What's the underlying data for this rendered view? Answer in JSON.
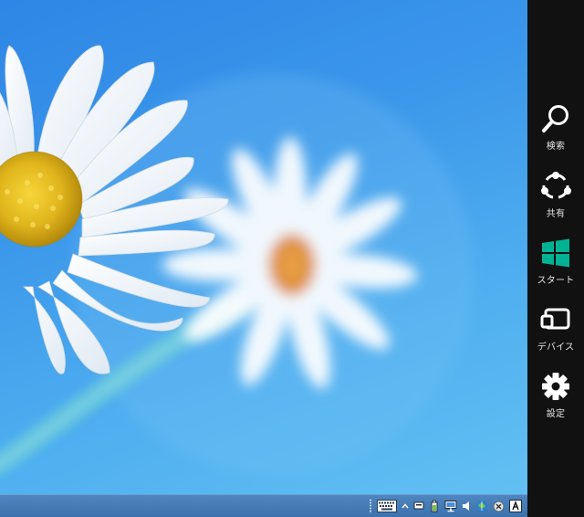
{
  "charms": {
    "search": {
      "label": "検索",
      "icon": "search-icon"
    },
    "share": {
      "label": "共有",
      "icon": "share-icon"
    },
    "start": {
      "label": "スタート",
      "icon": "windows-logo-icon",
      "color": "#00b294"
    },
    "devices": {
      "label": "デバイス",
      "icon": "devices-icon"
    },
    "settings": {
      "label": "設定",
      "icon": "gear-icon"
    }
  },
  "taskbar": {
    "tray_icons": [
      "touch-keyboard-icon",
      "show-hidden-icons-chevron",
      "action-center-flag-icon",
      "power-battery-icon",
      "network-icon",
      "volume-icon",
      "security-shield-icon",
      "close-circle-icon",
      "ime-input-icon"
    ]
  },
  "colors": {
    "charms_bar": "#111111",
    "taskbar": "#4177b3",
    "wallpaper": "#3a93e8",
    "start_accent": "#00b294"
  }
}
